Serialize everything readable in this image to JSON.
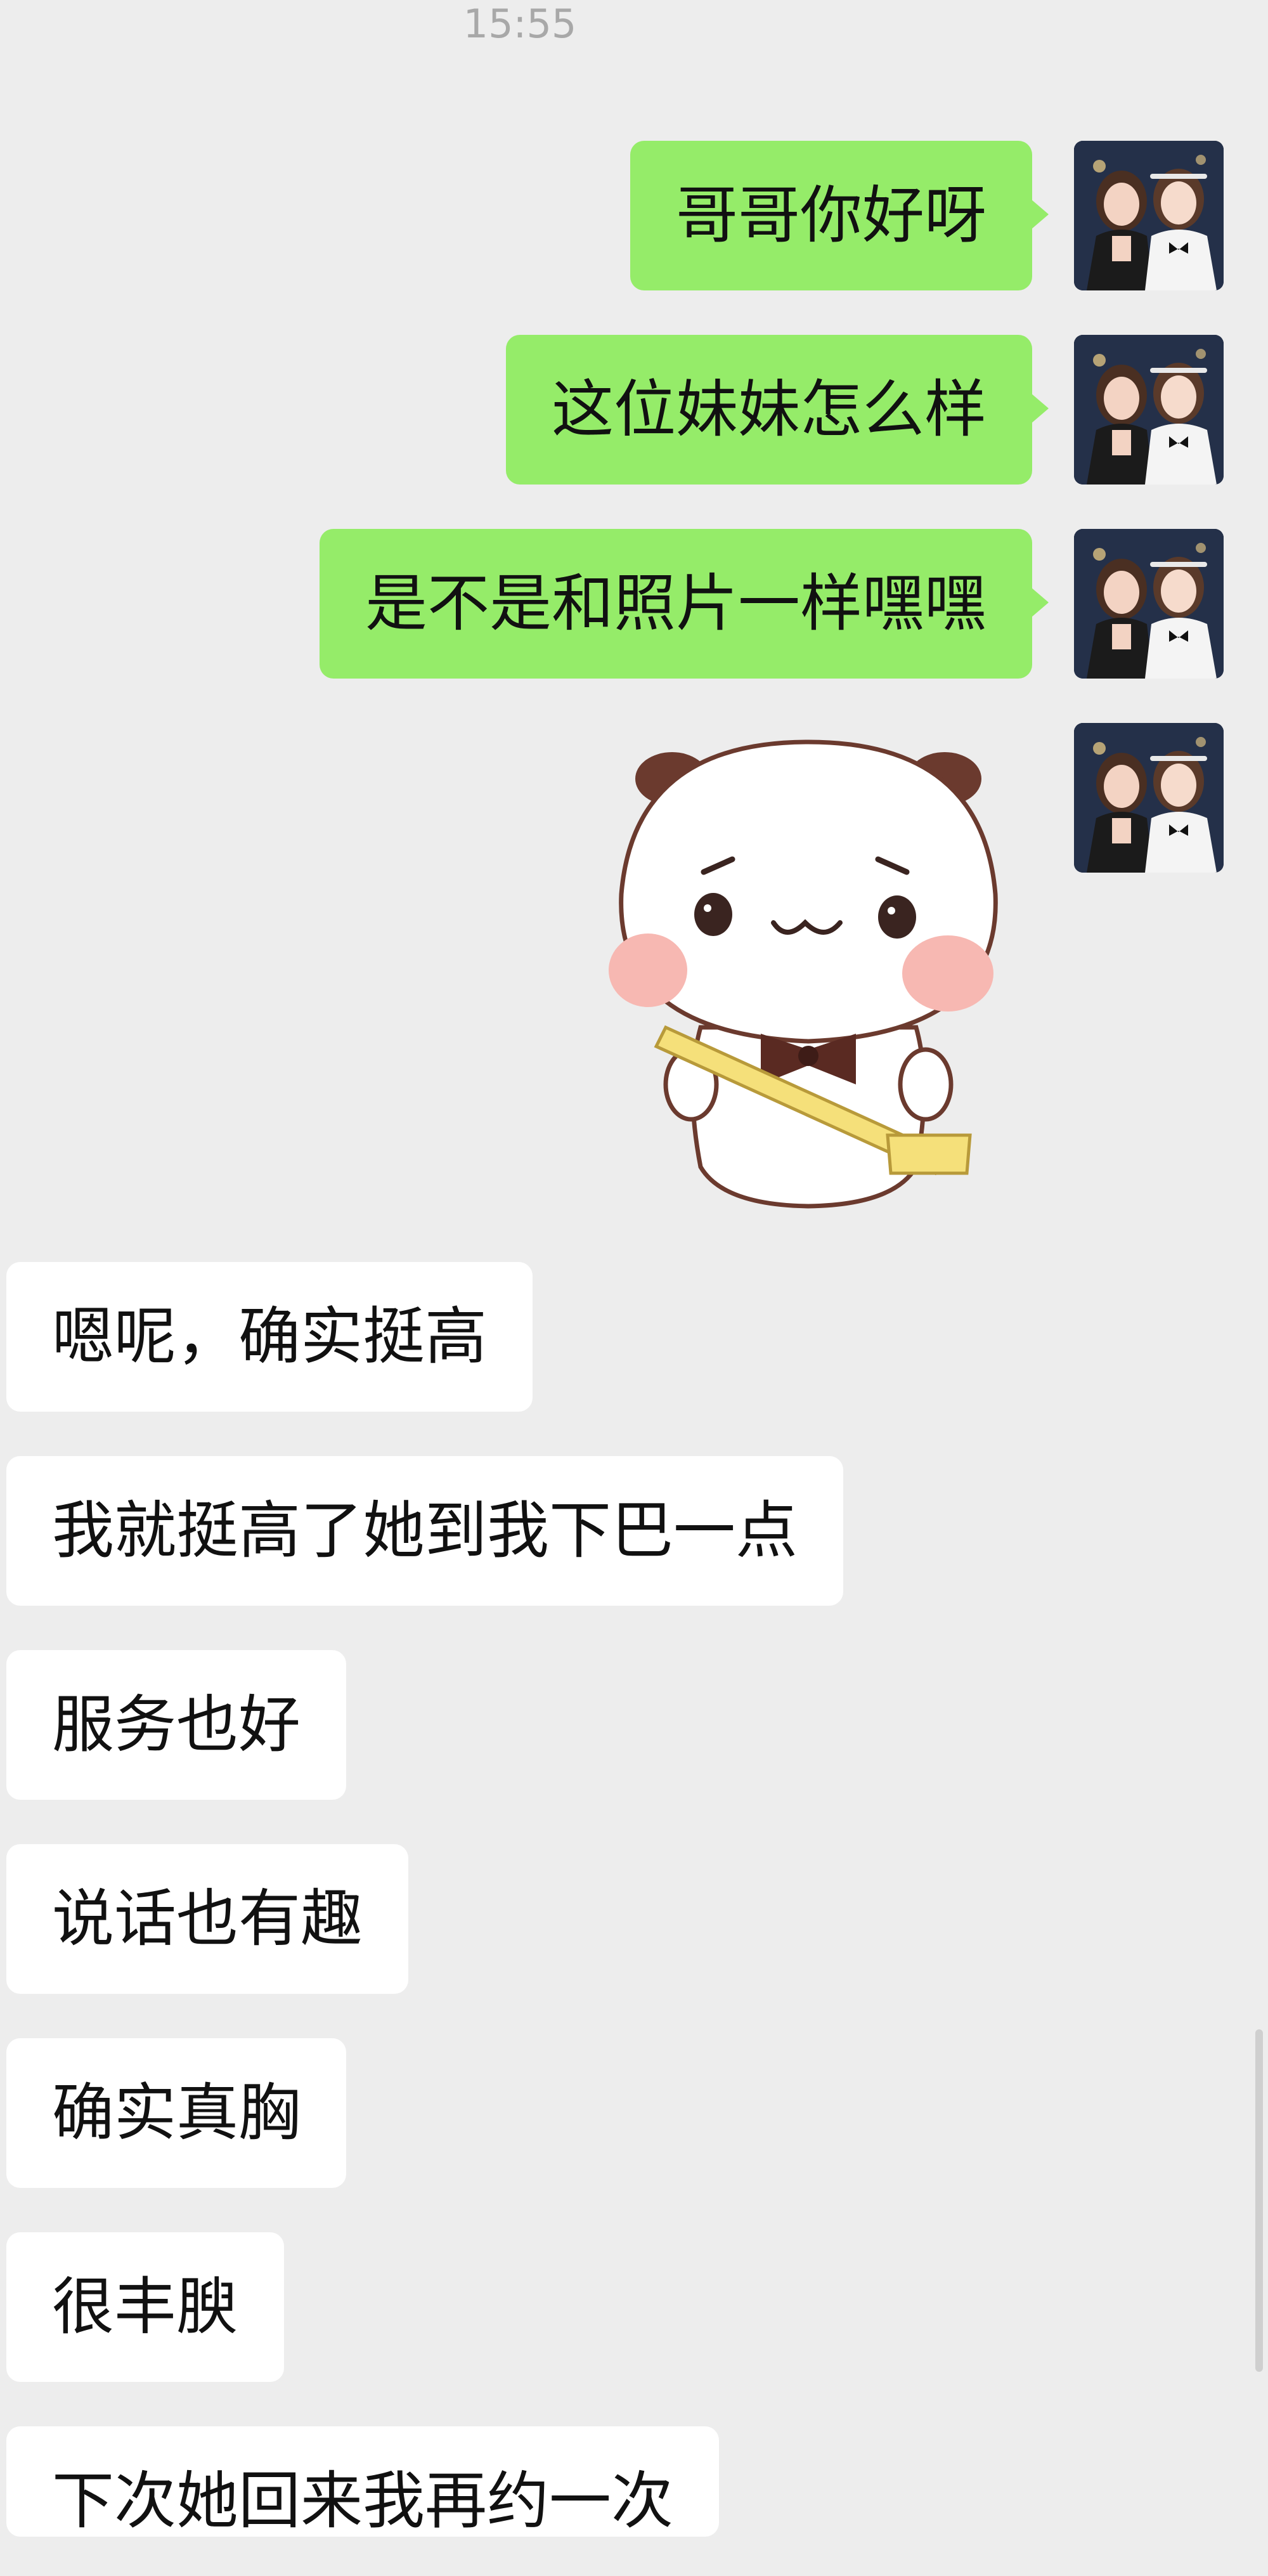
{
  "chat": {
    "timestamp": "15:55",
    "outgoing": [
      {
        "text": "哥哥你好呀"
      },
      {
        "text": "这位妹妹怎么样"
      },
      {
        "text": "是不是和照片一样嘿嘿"
      }
    ],
    "sticker": {
      "icon": "panda-sticker-icon"
    },
    "incoming": [
      {
        "text": "嗯呢，确实挺高"
      },
      {
        "text": "我就挺高了她到我下巴一点"
      },
      {
        "text": "服务也好"
      },
      {
        "text": "说话也有趣"
      },
      {
        "text": "确实真胸"
      },
      {
        "text": "很丰腴"
      },
      {
        "text": "下次她回来我再约一次"
      }
    ]
  },
  "colors": {
    "background": "#ededed",
    "outgoing_bubble": "#95ec69",
    "incoming_bubble": "#ffffff",
    "timestamp": "#a8a8a8"
  }
}
